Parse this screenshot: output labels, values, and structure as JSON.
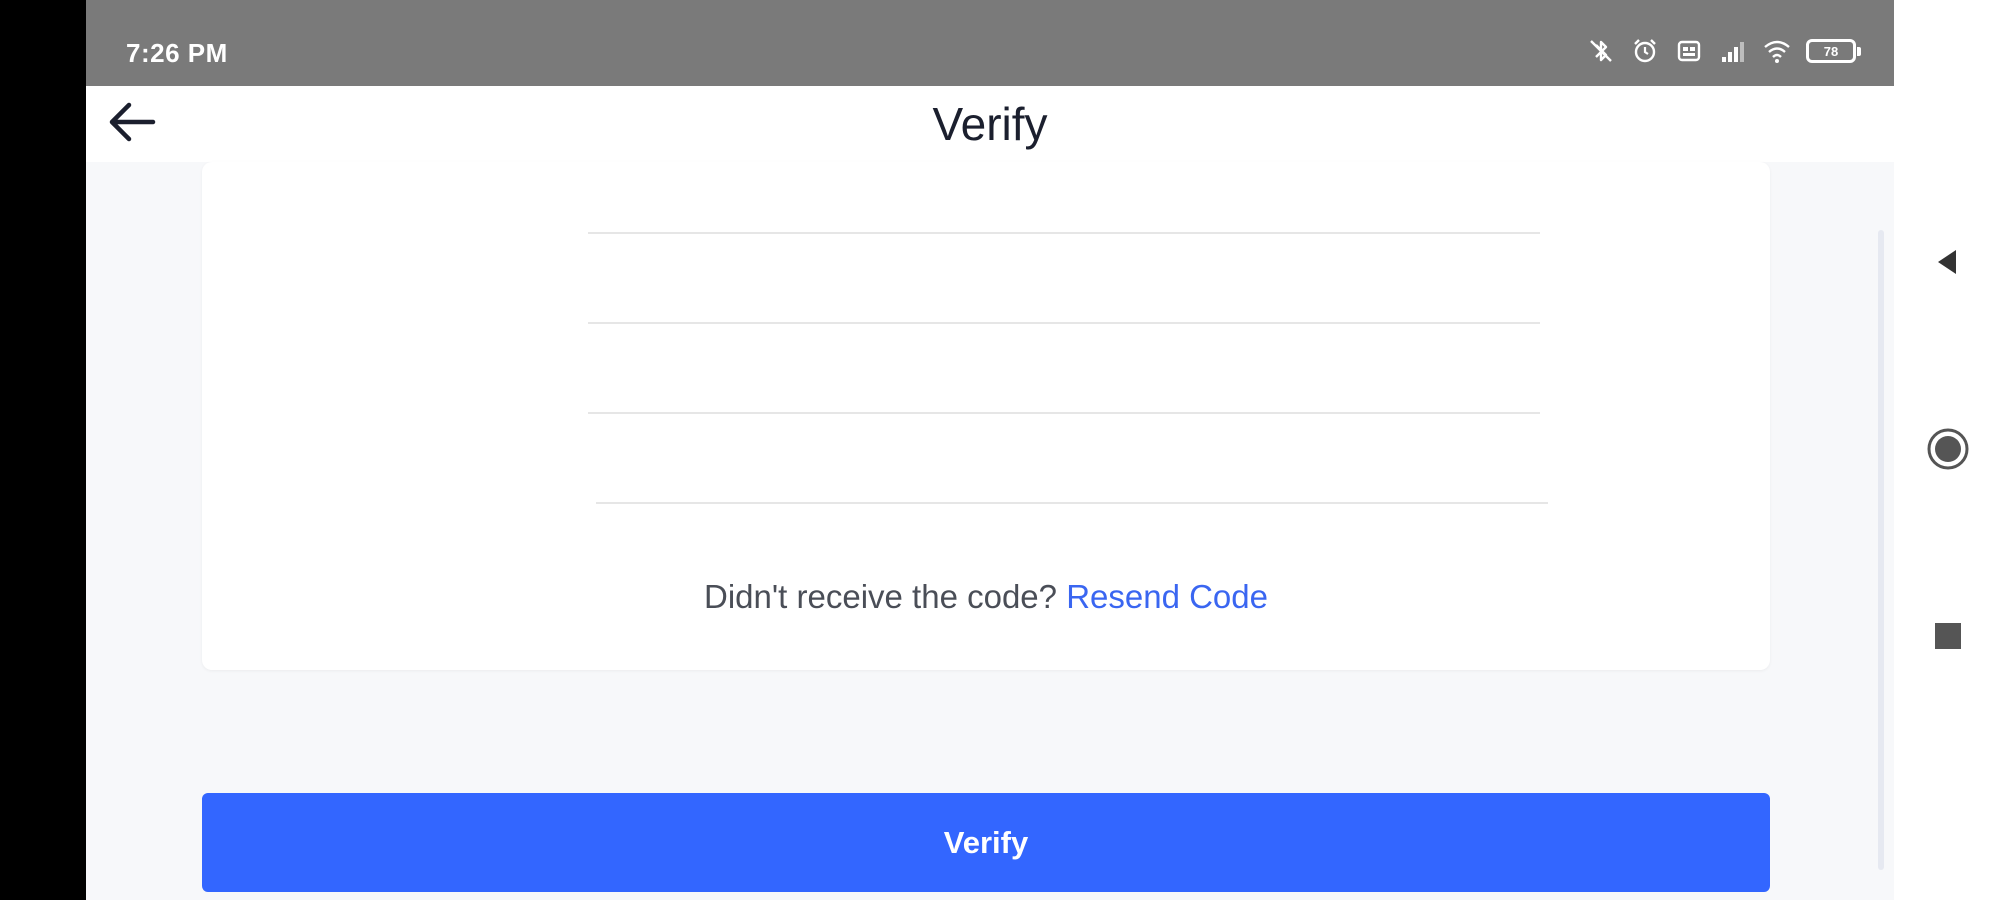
{
  "status_bar": {
    "time": "7:26 PM",
    "icons": [
      "bluetooth-off-icon",
      "alarm-icon",
      "sim-icon",
      "signal-icon",
      "wifi-icon",
      "battery-icon"
    ],
    "battery_level": "78"
  },
  "header": {
    "title": "Verify",
    "back_icon": "arrow-left-icon"
  },
  "verification": {
    "code_fields": [
      "",
      "",
      "",
      ""
    ],
    "resend_prompt": "Didn't receive the code?",
    "resend_link": "Resend Code"
  },
  "actions": {
    "verify_label": "Verify"
  },
  "nav_bar": {
    "icons": [
      "back-triangle-icon",
      "home-circle-icon",
      "recents-square-icon"
    ]
  },
  "colors": {
    "accent": "#3366ff",
    "link": "#3a66f1",
    "status_bar": "#7a7a7a",
    "title": "#1b1f2e"
  }
}
